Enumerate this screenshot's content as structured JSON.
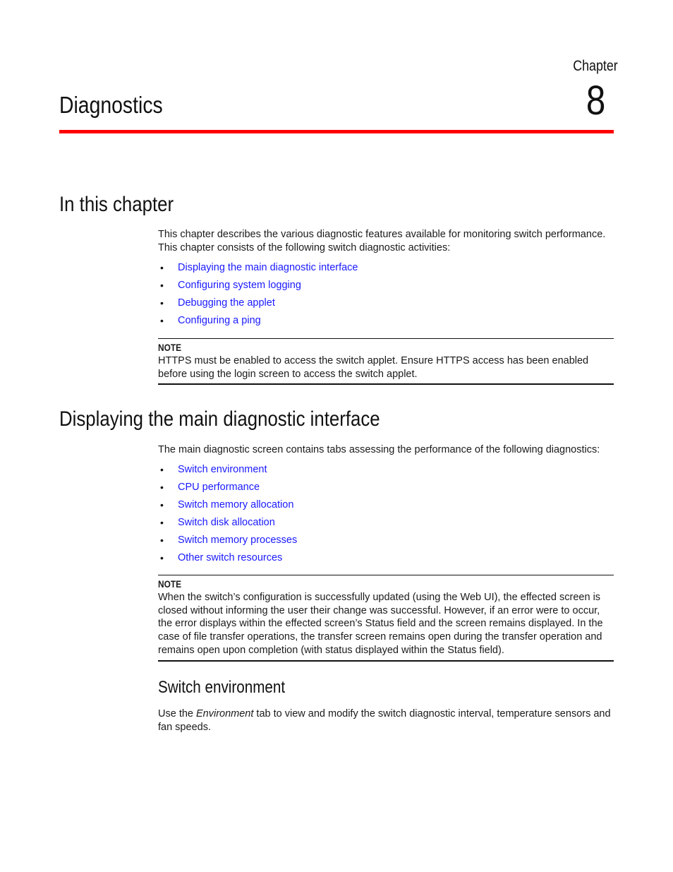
{
  "header": {
    "chapter_label": "Chapter",
    "chapter_number": "8",
    "chapter_title": "Diagnostics",
    "accent_color": "#ff0000"
  },
  "in_this_chapter": {
    "heading": "In this chapter",
    "intro": "This chapter describes the various diagnostic features available for monitoring switch performance. This chapter consists of the following switch diagnostic activities:",
    "links": [
      "Displaying the main diagnostic interface",
      "Configuring system logging",
      "Debugging the applet",
      "Configuring a ping"
    ],
    "note": {
      "label": "NOTE",
      "text": "HTTPS must be enabled to access the switch applet. Ensure HTTPS access has been enabled before using the login screen to access the switch applet."
    }
  },
  "main_diagnostic": {
    "heading": "Displaying the main diagnostic interface",
    "intro": "The main diagnostic screen contains tabs assessing the performance of the following diagnostics:",
    "links": [
      "Switch environment",
      "CPU performance",
      "Switch memory allocation",
      "Switch disk allocation",
      "Switch memory processes",
      "Other switch resources"
    ],
    "note": {
      "label": "NOTE",
      "text": "When the switch’s configuration is successfully updated (using the Web UI), the effected screen is closed without informing the user their change was successful. However, if an error were to occur, the error displays within the effected screen’s Status field and the screen remains displayed. In the case of file transfer operations, the transfer screen remains open during the transfer operation and remains open upon completion (with status displayed within the Status field)."
    }
  },
  "switch_environment": {
    "heading": "Switch environment",
    "text_before": "Use the ",
    "text_emphasis": "Environment",
    "text_after": " tab to view and modify the switch diagnostic interval, temperature sensors and fan speeds."
  },
  "link_color": "#1a1aff",
  "bullet_glyph": "•"
}
